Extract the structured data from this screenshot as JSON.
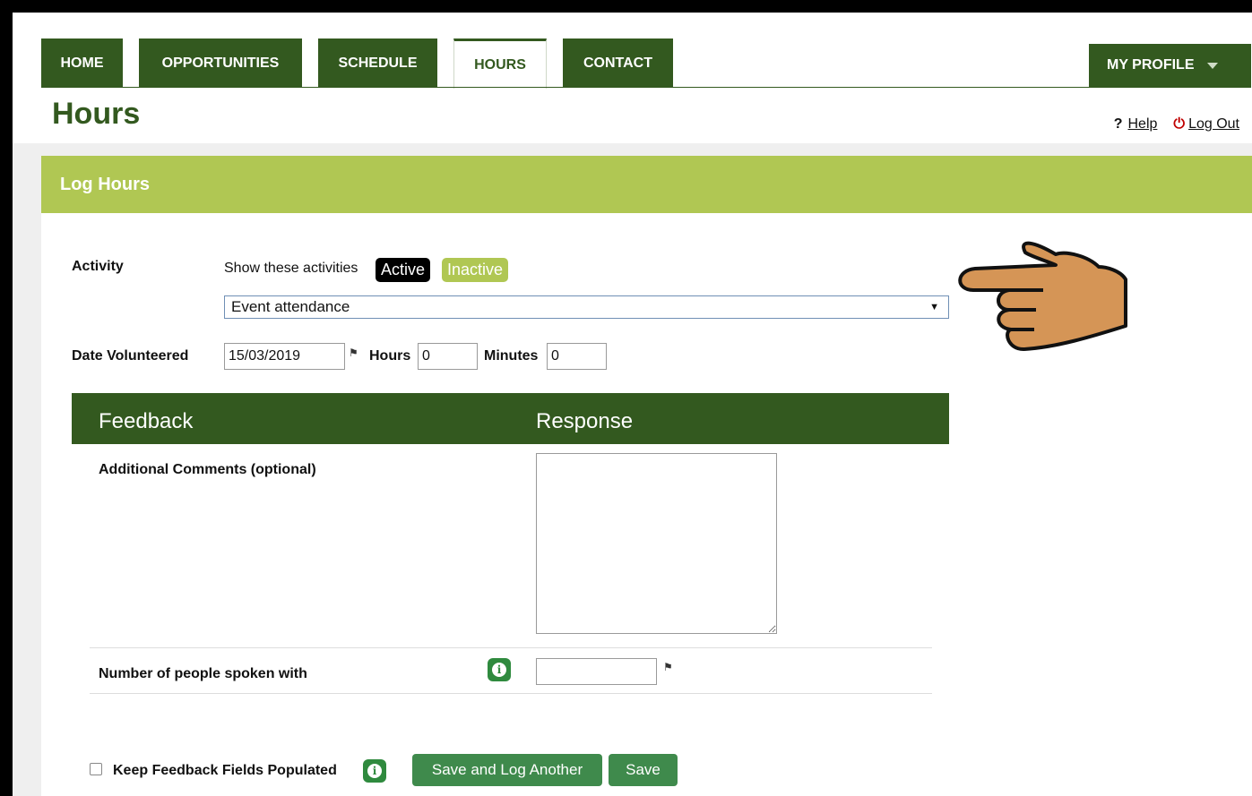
{
  "nav": {
    "tabs": [
      {
        "label": "HOME"
      },
      {
        "label": "OPPORTUNITIES"
      },
      {
        "label": "SCHEDULE"
      },
      {
        "label": "HOURS",
        "active": true
      },
      {
        "label": "CONTACT"
      }
    ],
    "profile_label": "MY PROFILE"
  },
  "page": {
    "title": "Hours",
    "help_symbol": "?",
    "help_label": "Help",
    "logout_label": "Log Out"
  },
  "form": {
    "header": "Log Hours",
    "activity_label": "Activity",
    "show_label": "Show these activities",
    "active_label": "Active",
    "inactive_label": "Inactive",
    "activity_value": "Event attendance",
    "date_label": "Date Volunteered",
    "date_value": "15/03/2019",
    "hours_label": "Hours",
    "hours_value": "0",
    "minutes_label": "Minutes",
    "minutes_value": "0"
  },
  "feedback": {
    "col_feedback": "Feedback",
    "col_response": "Response",
    "comments_label": "Additional Comments (optional)",
    "comments_value": "",
    "people_label": "Number of people spoken with",
    "people_value": ""
  },
  "footer": {
    "keep_label": "Keep Feedback Fields Populated",
    "keep_checked": false,
    "save_another_label": "Save and Log Another",
    "save_label": "Save"
  },
  "colors": {
    "dark_green": "#33591f",
    "lime": "#b0c753",
    "button_green": "#3f8a4c"
  }
}
